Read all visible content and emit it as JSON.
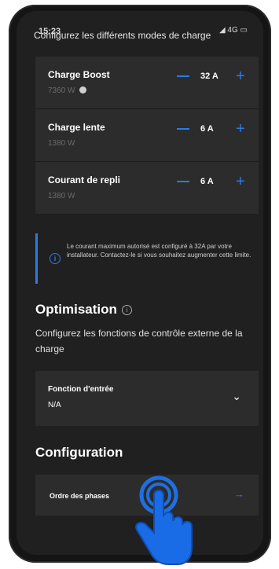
{
  "status_bar": {
    "time": "15:23",
    "icons": "◢ 4G ▭"
  },
  "top_heading": "Configurez les différents modes de charge",
  "charge_modes": [
    {
      "title": "Charge Boost",
      "power": "7360 W",
      "value": "32 A",
      "has_badge": true
    },
    {
      "title": "Charge lente",
      "power": "1380 W",
      "value": "6 A",
      "has_badge": false
    },
    {
      "title": "Courant de repli",
      "power": "1380 W",
      "value": "6 A",
      "has_badge": false
    }
  ],
  "info_banner": {
    "icon": "info-icon",
    "text": "Le courant maximum autorisé est configuré à 32A par votre installateur. Contactez-le si vous souhaitez augmenter cette limite."
  },
  "optimisation": {
    "title": "Optimisation",
    "description": "Configurez les fonctions de contrôle externe de la charge",
    "input_function": {
      "label": "Fonction d'entrée",
      "value": "N/A"
    }
  },
  "configuration": {
    "title": "Configuration",
    "phase_order": {
      "label": "Ordre des phases"
    }
  },
  "colors": {
    "accent": "#2c7be5",
    "card": "#2c2c2c",
    "background": "#202020"
  }
}
